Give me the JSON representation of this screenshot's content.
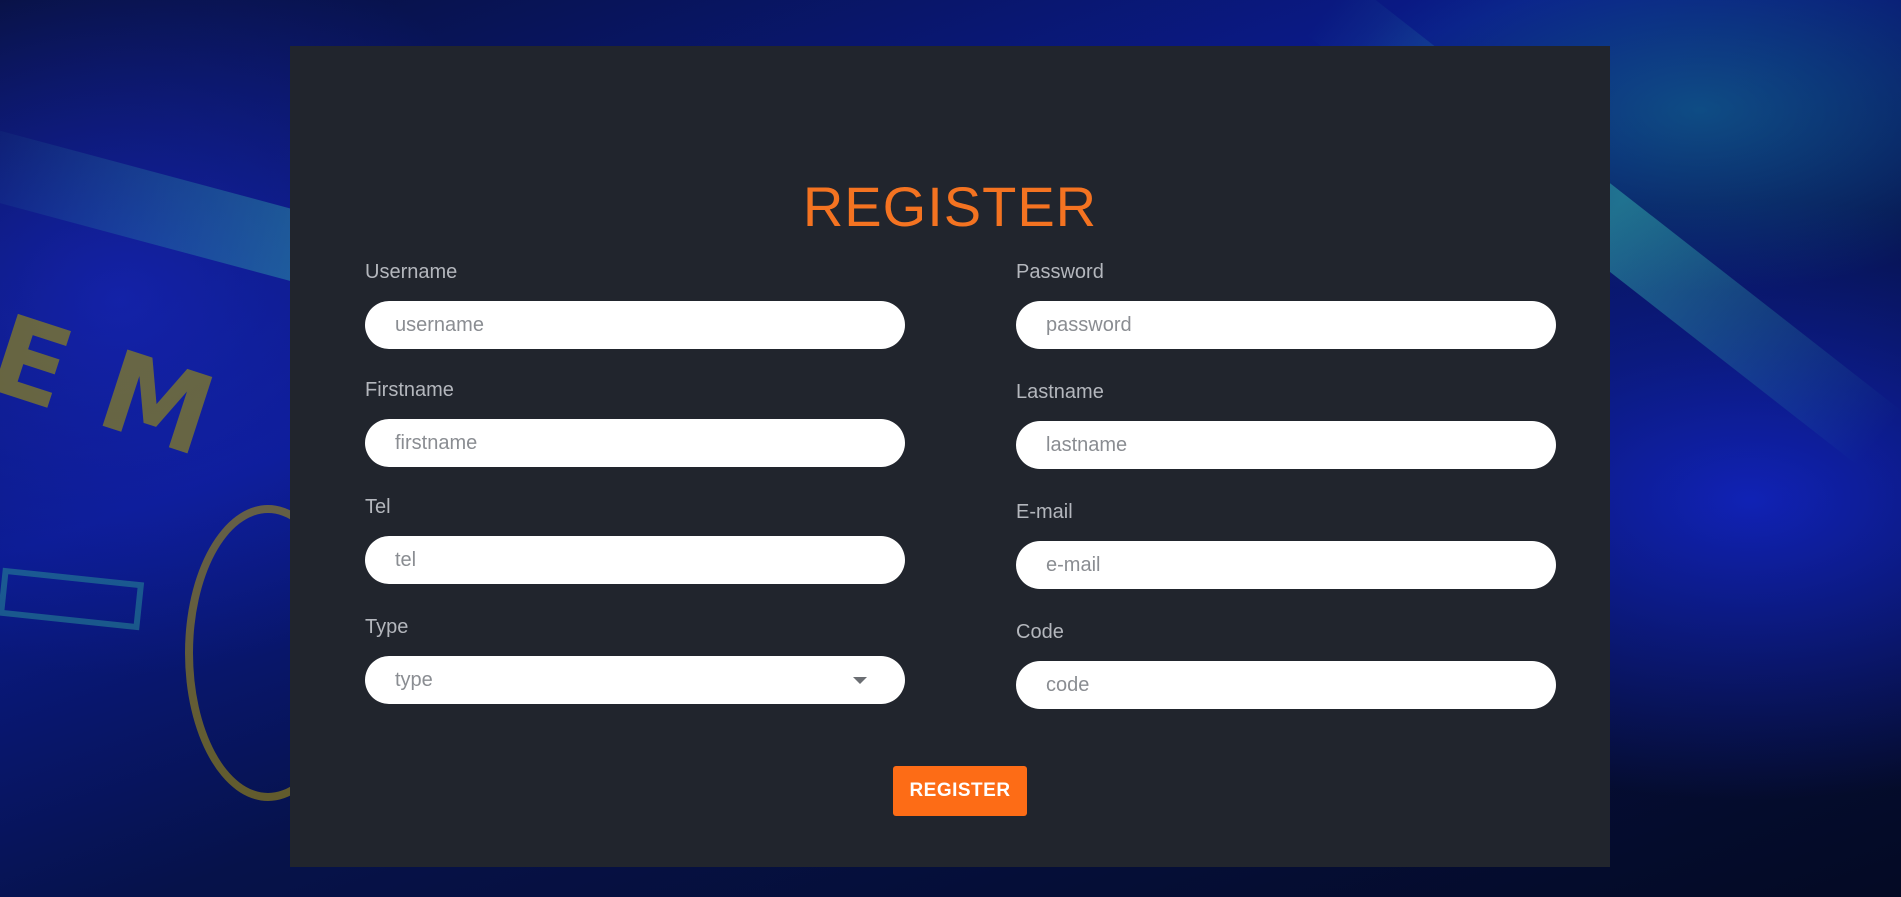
{
  "colors": {
    "accent": "#f47321",
    "button": "#fd6c16",
    "card_background": "#21252d",
    "label": "#b4b7bd"
  },
  "form": {
    "title": "REGISTER",
    "fields": {
      "username": {
        "label": "Username",
        "placeholder": "username"
      },
      "password": {
        "label": "Password",
        "placeholder": "password"
      },
      "firstname": {
        "label": "Firstname",
        "placeholder": "firstname"
      },
      "lastname": {
        "label": "Lastname",
        "placeholder": "lastname"
      },
      "tel": {
        "label": "Tel",
        "placeholder": "tel"
      },
      "email": {
        "label": "E-mail",
        "placeholder": "e-mail"
      },
      "type": {
        "label": "Type",
        "selected": "type",
        "icon": "chevron-down-icon"
      },
      "code": {
        "label": "Code",
        "placeholder": "code"
      }
    },
    "submit_label": "REGISTER"
  }
}
